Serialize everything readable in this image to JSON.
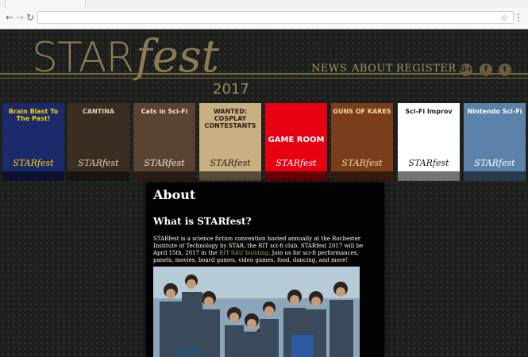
{
  "colors": {
    "accent_gold": "#8c7a54",
    "link_gold": "#b29e63",
    "page_bg": "#1c1f1c",
    "content_bg": "#000000"
  },
  "header": {
    "logo_star": "STAR",
    "logo_fest": "fest",
    "year": "2017",
    "nav": [
      {
        "label": "NEWS"
      },
      {
        "label": "ABOUT"
      },
      {
        "label": "REGISTER"
      }
    ],
    "social": [
      {
        "icon": "google-plus-icon",
        "glyph": "G+"
      },
      {
        "icon": "facebook-icon",
        "glyph": "f"
      },
      {
        "icon": "twitter-icon",
        "glyph": "t"
      }
    ]
  },
  "posters": [
    {
      "title": "Brain Blast To The Past!",
      "brand": "STARfest",
      "bg": "#1b2a6b",
      "fg": "#ffd200"
    },
    {
      "title": "CANTINA",
      "brand": "STARfest",
      "bg": "#3a2d22",
      "fg": "#e4d2b0"
    },
    {
      "title": "Cats in Sci-Fi",
      "brand": "STARfest",
      "bg": "#5a4233",
      "fg": "#f2e6d0"
    },
    {
      "title": "WANTED: COSPLAY CONTESTANTS",
      "brand": "STARfest",
      "bg": "#c9b083",
      "fg": "#2a1d0f"
    },
    {
      "title": "GAME ROOM",
      "brand": "STARfest",
      "bg": "#e60012",
      "fg": "#ffffff"
    },
    {
      "title": "GUNS OF KARES",
      "brand": "STARfest",
      "bg": "#7a3f1a",
      "fg": "#f3d9a1"
    },
    {
      "title": "Sci-Fi Improv",
      "brand": "STARfest",
      "bg": "#ffffff",
      "fg": "#1b1b1b"
    },
    {
      "title": "Nintendo Sci-Fi",
      "brand": "STARfest",
      "bg": "#5b82a8",
      "fg": "#ffffff"
    }
  ],
  "content": {
    "heading": "About",
    "subheading": "What is STARfest?",
    "paragraph_before_link": "STARfest is a science fiction convention hosted annually at the Rochester Institute of Technology by STAR, the RIT sci-fi club.  STARfest 2017 will be April 15th, 2017 in the ",
    "link_text": "RIT SAU building",
    "paragraph_after_link": ".  Join us for sci-fi performances, panels, movies, board games, video games, food, dancing, and more!",
    "photo_caption": "group photo"
  }
}
